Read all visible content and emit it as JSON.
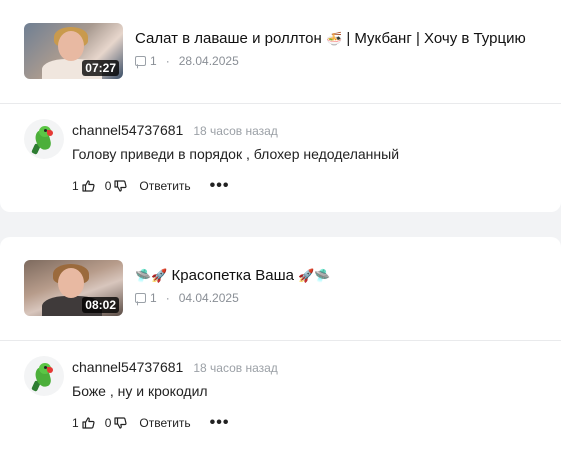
{
  "items": [
    {
      "video": {
        "duration": "07:27",
        "title": "Салат в лаваше и роллтон",
        "title_emoji": "🍜",
        "title_suffix": "| Мукбанг | Хочу в Турцию",
        "comments_count": "1",
        "date": "28.04.2025"
      },
      "comment": {
        "author": "channel54737681",
        "time": "18 часов назад",
        "text": "Голову приведи в порядок , блохер недоделанный",
        "likes": "1",
        "dislikes": "0",
        "reply_label": "Ответить",
        "more_label": "•••"
      }
    },
    {
      "video": {
        "duration": "08:02",
        "title_prefix_emoji": "🛸🚀",
        "title": "Красопетка Ваша",
        "title_emoji": "🚀🛸",
        "comments_count": "1",
        "date": "04.04.2025"
      },
      "comment": {
        "author": "channel54737681",
        "time": "18 часов назад",
        "text": "Боже , ну и крокодил",
        "likes": "1",
        "dislikes": "0",
        "reply_label": "Ответить",
        "more_label": "•••"
      }
    }
  ]
}
